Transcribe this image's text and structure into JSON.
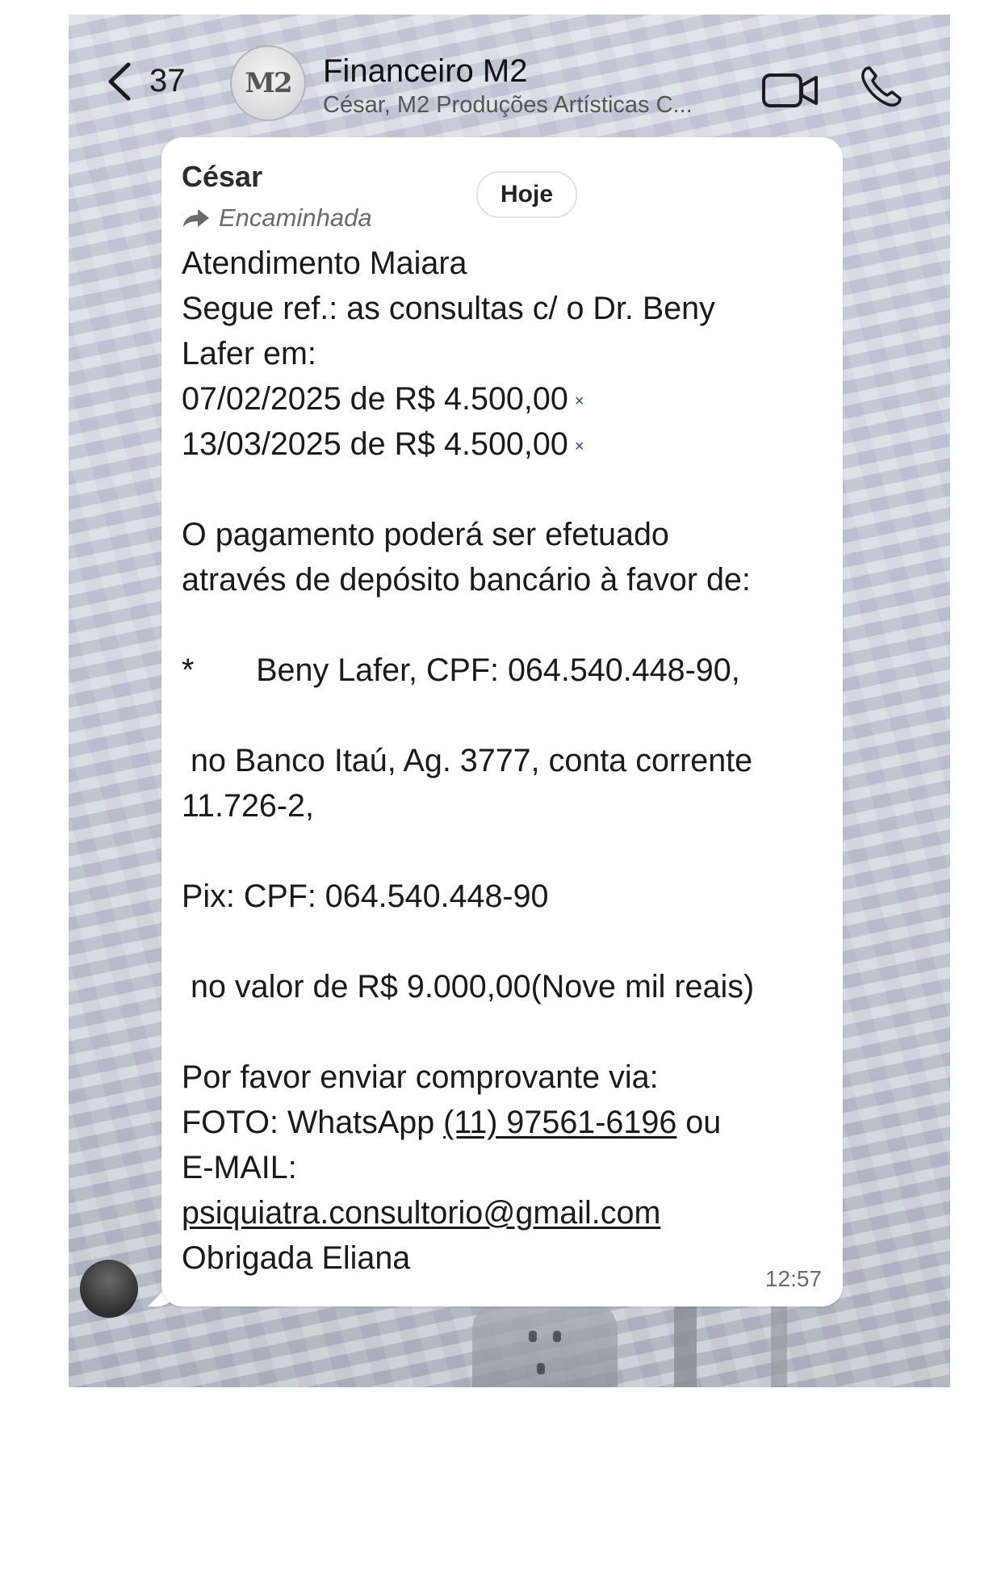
{
  "header": {
    "back_count": "37",
    "avatar_text": "M2",
    "title": "Financeiro M2",
    "subtitle": "César, M2 Produções Artísticas C..."
  },
  "message": {
    "sender": "César",
    "date_pill": "Hoje",
    "forwarded_label": "Encaminhada",
    "lines": [
      "Atendimento Maiara",
      "Segue ref.:  as consultas c/ o Dr. Beny",
      "Lafer   em:",
      "07/02/2025 de R$ 4.500,00",
      "13/03/2025 de R$ 4.500,00",
      "",
      "O pagamento poderá ser efetuado",
      "através de depósito bancário à favor de:",
      "",
      "*       Beny Lafer, CPF: 064.540.448-90,",
      "",
      " no Banco Itaú, Ag. 3777, conta corrente",
      "11.726-2,",
      "",
      "Pix: CPF: 064.540.448-90",
      "",
      " no valor de R$ 9.000,00(Nove mil reais)",
      "",
      "Por favor enviar comprovante via:"
    ],
    "foto_prefix": "FOTO: WhatsApp ",
    "phone_link": "(11) 97561-6196",
    "foto_suffix": " ou",
    "email_label": "E-MAIL:",
    "email_link": "psiquiatra.consultorio@gmail.com",
    "closing": "Obrigada Eliana",
    "time": "12:57",
    "handwritten_mark": "×"
  },
  "icons": {
    "back": "chevron-left-icon",
    "video": "video-camera-icon",
    "phone": "phone-icon",
    "forward": "forward-arrow-icon"
  },
  "colors": {
    "bubble": "#ffffff",
    "text": "#1a1a1a",
    "handwritten_mark": "#2a3f9e"
  }
}
